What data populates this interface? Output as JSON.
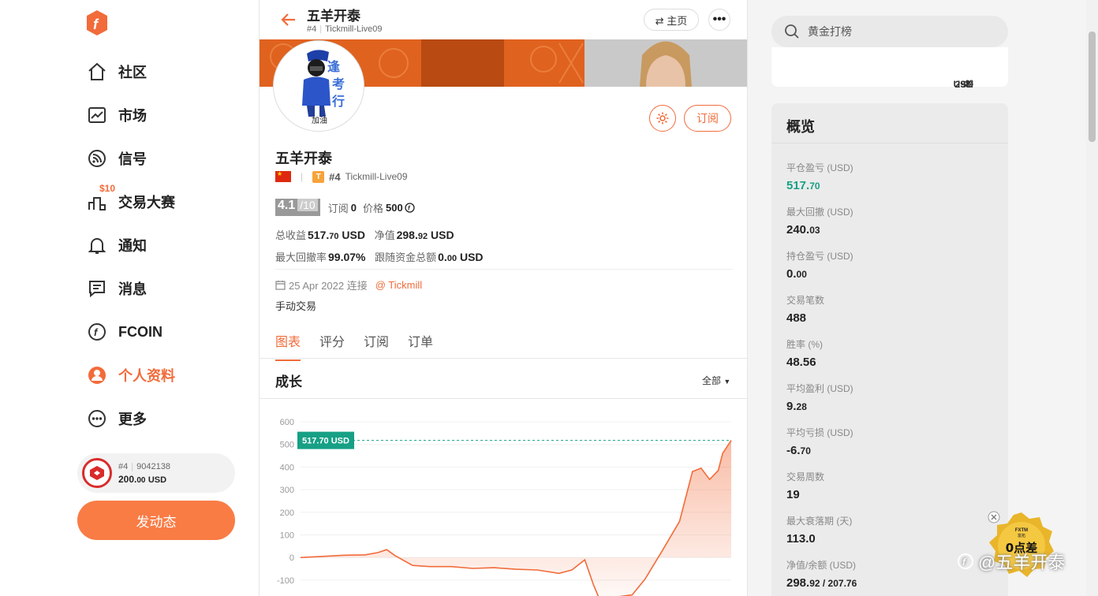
{
  "sidebar": {
    "items": [
      {
        "label": "社区",
        "icon": "home-icon"
      },
      {
        "label": "市场",
        "icon": "chart-icon"
      },
      {
        "label": "信号",
        "icon": "signal-icon"
      },
      {
        "label": "交易大赛",
        "icon": "podium-icon",
        "badge": "$10"
      },
      {
        "label": "通知",
        "icon": "bell-icon"
      },
      {
        "label": "消息",
        "icon": "message-icon"
      },
      {
        "label": "FCOIN",
        "icon": "fcoin-icon"
      },
      {
        "label": "个人资料",
        "icon": "profile-icon",
        "active": true
      },
      {
        "label": "更多",
        "icon": "more-icon"
      }
    ],
    "account": {
      "rank": "#4",
      "id": "9042138",
      "balance_int": "200.",
      "balance_dec": "00",
      "currency": "USD"
    },
    "post_button": "发动态"
  },
  "header": {
    "title": "五羊开泰",
    "rank": "#4",
    "account": "Tickmill-Live09",
    "home_button": "⇄ 主页",
    "more_button": "•••"
  },
  "profile": {
    "name": "五羊开泰",
    "badge_letter": "T",
    "rank": "#4",
    "account": "Tickmill-Live09",
    "subscribe_button": "订阅",
    "score": "4.1",
    "score_max": "/10",
    "subscribers_label": "订阅",
    "subscribers": "0",
    "price_label": "价格",
    "price": "500",
    "total_profit_label": "总收益",
    "total_profit_int": "517.",
    "total_profit_dec": "70",
    "equity_label": "净值",
    "equity_int": "298.",
    "equity_dec": "92",
    "currency": "USD",
    "max_drawdown_label": "最大回撤率",
    "max_drawdown": "99.07%",
    "follow_funds_label": "跟随资金总额",
    "follow_funds_int": "0.",
    "follow_funds_dec": "00",
    "connected": "25 Apr 2022 连接",
    "broker": "@ Tickmill",
    "description": "手动交易"
  },
  "tabs": [
    "图表",
    "评分",
    "订阅",
    "订单"
  ],
  "growth": {
    "title": "成长",
    "range": "全部"
  },
  "chart_data": {
    "type": "area",
    "title": "成长",
    "yticks": [
      600,
      500,
      400,
      300,
      200,
      100,
      0,
      -100
    ],
    "ylim": [
      -150,
      600
    ],
    "current_label": "517.70 USD",
    "current_value": 517.7,
    "x": [
      0,
      5,
      10,
      15,
      18,
      20,
      22,
      26,
      30,
      35,
      40,
      45,
      50,
      55,
      60,
      63,
      66,
      68,
      70,
      73,
      77,
      80,
      84,
      88,
      91,
      93,
      95,
      97,
      98,
      100
    ],
    "values": [
      0,
      5,
      10,
      12,
      22,
      35,
      8,
      -35,
      -40,
      -40,
      -48,
      -45,
      -52,
      -55,
      -70,
      -55,
      -10,
      -120,
      -210,
      -175,
      -165,
      -95,
      30,
      160,
      380,
      395,
      345,
      385,
      460,
      517.7
    ]
  },
  "search": {
    "placeholder": "黄金打榜"
  },
  "equity_card": {
    "value_int": "298.",
    "value_dec": "92",
    "currency": "USD"
  },
  "overview": {
    "title": "概览",
    "items": [
      {
        "label": "平仓盈亏 (USD)",
        "int": "517.",
        "dec": "70",
        "green": true
      },
      {
        "label": "最大回撤 (USD)",
        "int": "240.",
        "dec": "03"
      },
      {
        "label": "持仓盈亏 (USD)",
        "int": "0.",
        "dec": "00"
      },
      {
        "label": "交易笔数",
        "int": "488",
        "dec": ""
      },
      {
        "label": "胜率 (%)",
        "int": "48.56",
        "dec": ""
      },
      {
        "label": "平均盈利 (USD)",
        "int": "9.",
        "dec": "28"
      },
      {
        "label": "平均亏损 (USD)",
        "int": "-6.",
        "dec": "70"
      },
      {
        "label": "交易周数",
        "int": "19",
        "dec": ""
      },
      {
        "label": "最大衰落期 (天)",
        "int": "113.0",
        "dec": ""
      },
      {
        "label": "净值/余额 (USD)",
        "int": "298.",
        "dec": "92 / 207.76"
      }
    ]
  },
  "watermark": "@五羊开泰",
  "ad": {
    "brand": "FXTM",
    "sub": "富拓",
    "text": "0点差"
  },
  "colors": {
    "accent": "#f26b3a",
    "green": "#16a085",
    "button": "#f97c45"
  }
}
